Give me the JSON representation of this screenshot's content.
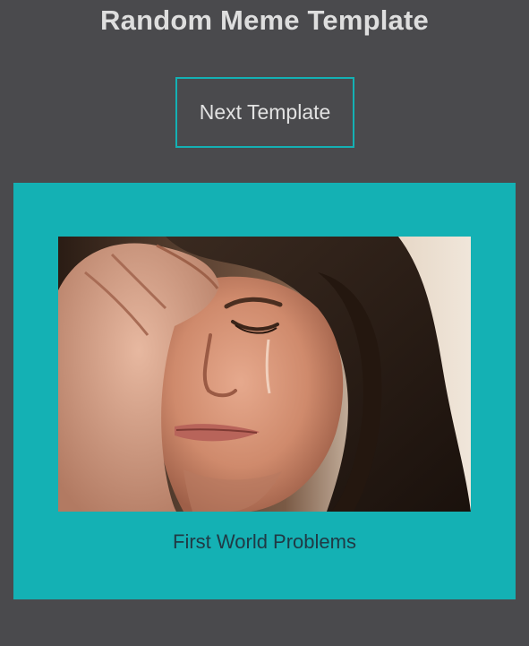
{
  "page": {
    "title": "Random Meme Template"
  },
  "controls": {
    "next_label": "Next Template"
  },
  "meme": {
    "name": "First World Problems"
  },
  "colors": {
    "background": "#4a4a4d",
    "accent": "#14b1b4",
    "title_text": "#dedede",
    "caption_text": "#203a45"
  }
}
